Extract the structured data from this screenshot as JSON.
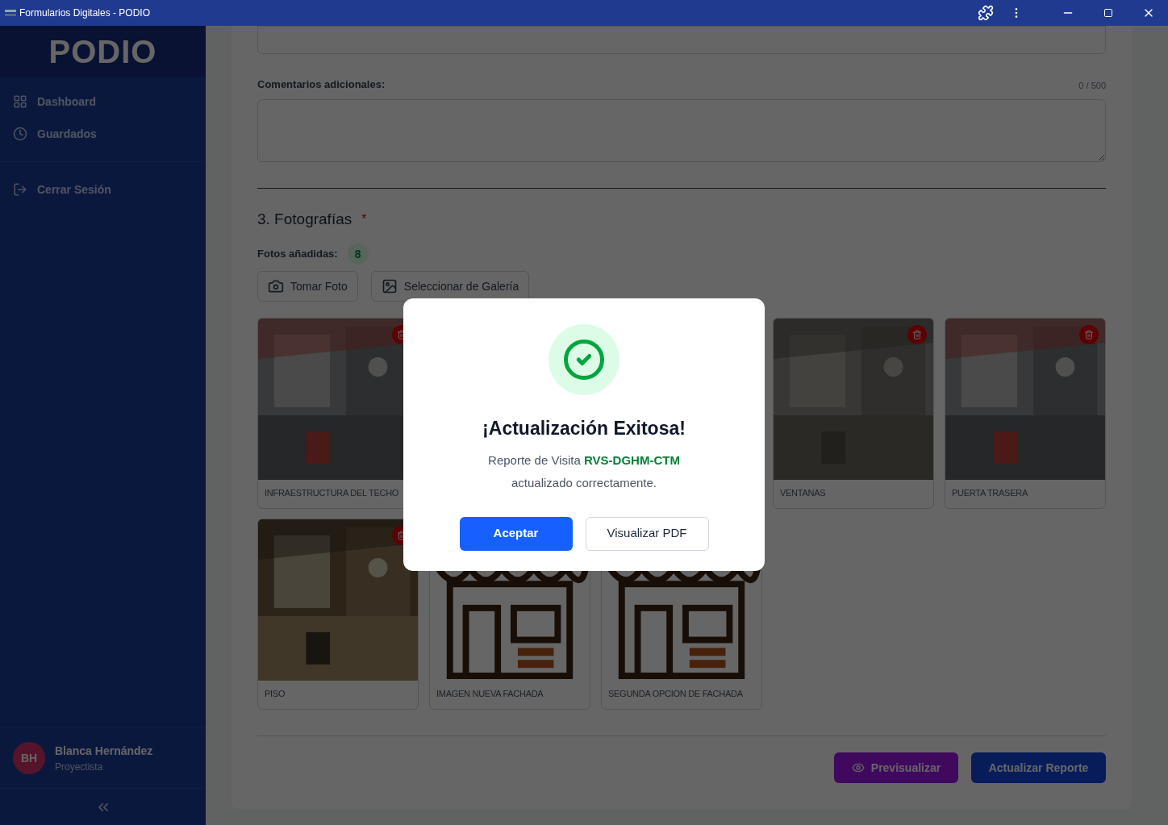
{
  "window": {
    "title": "Formularios Digitales - PODIO"
  },
  "sidebar": {
    "logo": "PODIO",
    "items": [
      {
        "label": "Dashboard"
      },
      {
        "label": "Guardados"
      }
    ],
    "logout": "Cerrar Sesión",
    "user": {
      "initials": "BH",
      "name": "Blanca Hernández",
      "role": "Proyectista"
    }
  },
  "form": {
    "comments_label": "Comentarios adicionales:",
    "comments_counter": "0 / 500",
    "section_title": "3. Fotografías",
    "required_mark": "*",
    "photos_label": "Fotos añadidas:",
    "photos_count": "8",
    "take_photo": "Tomar Foto",
    "gallery": "Seleccionar de Galería",
    "photo_rows": [
      [
        {
          "label": "INFRAESTRUCTURA DEL TECHO"
        },
        null,
        null,
        {
          "label": "VENTANAS"
        },
        {
          "label": "PUERTA TRASERA"
        }
      ],
      [
        {
          "label": "PISO"
        },
        {
          "kind": "storefront",
          "label": "IMAGEN NUEVA FACHADA"
        },
        {
          "kind": "storefront",
          "label": "SEGUNDA OPCION DE FACHADA"
        },
        null,
        null
      ]
    ],
    "preview_button": "Previsualizar",
    "update_button": "Actualizar Reporte"
  },
  "dialog": {
    "title": "¡Actualización Exitosa!",
    "message": "Reporte de Visita",
    "code": "RVS-DGHM-CTM",
    "message_end": "actualizado correctamente.",
    "accept": "Aceptar",
    "view_pdf": "Visualizar PDF"
  }
}
